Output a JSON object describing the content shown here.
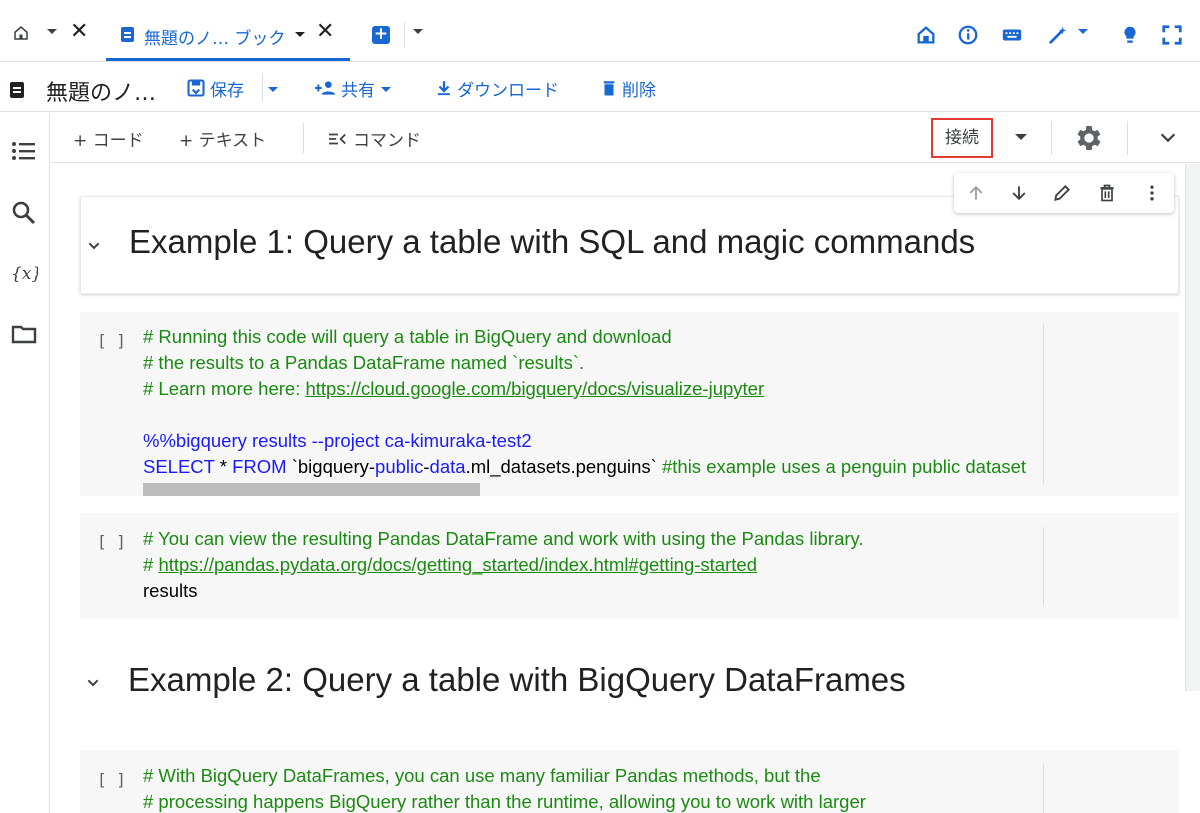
{
  "tabbar": {
    "active_tab_title": "無題のノ… ブック",
    "close_glyph": "✕",
    "new_tab_glyph": "+"
  },
  "toolbar": {
    "notebook_title": "無題のノ…",
    "save_label": "保存",
    "share_label": "共有",
    "download_label": "ダウンロード",
    "delete_label": "削除"
  },
  "commands": {
    "add_code": "+ コード",
    "add_text": "+ テキスト",
    "command_palette": "コマンド",
    "connect": "接続"
  },
  "cells": {
    "heading1": "Example 1: Query a table with SQL and magic commands",
    "code1": {
      "bracket": "[ ]",
      "line1": "# Running this code will query a table in BigQuery and download",
      "line2": "# the results to a Pandas DataFrame named `results`.",
      "line3_prefix": "# Learn more here: ",
      "line3_link": "https://cloud.google.com/bigquery/docs/visualize-jupyter",
      "line5": "%%bigquery results --project ca-kimuraka-test2",
      "line6_select": "SELECT",
      "line6_star": " * ",
      "line6_from": "FROM",
      "line6_tick1": " `bigquery-",
      "line6_public": "public",
      "line6_dash": "-",
      "line6_data": "data",
      "line6_rest": ".ml_datasets.penguins` ",
      "line6_comment": "#this example uses a penguin public dataset"
    },
    "code2": {
      "bracket": "[ ]",
      "line1": "# You can view the resulting Pandas DataFrame and work with using the Pandas library.",
      "line2_prefix": "# ",
      "line2_link": "https://pandas.pydata.org/docs/getting_started/index.html#getting-started",
      "line3": "results"
    },
    "heading2": "Example 2: Query a table with BigQuery DataFrames",
    "code3": {
      "bracket": "[ ]",
      "line1": "# With BigQuery DataFrames, you can use many familiar Pandas methods, but the",
      "line2": "# processing happens BigQuery rather than the runtime, allowing you to work with larger"
    }
  },
  "colors": {
    "accent": "#1967d2",
    "comment": "#1b8a12",
    "keyword": "#1a1aff",
    "connect_highlight": "#e53935"
  },
  "icons": {
    "tabbar": [
      "home-icon",
      "close-icon",
      "doc-icon",
      "add-tab-icon",
      "drive-icon",
      "info-icon",
      "keyboard-icon",
      "magic-wand-icon",
      "lightbulb-icon",
      "fullscreen-icon"
    ],
    "sidebar": [
      "toc-icon",
      "search-icon",
      "variables-icon",
      "folder-icon"
    ],
    "cell_toolbar": [
      "arrow-up-icon",
      "arrow-down-icon",
      "pencil-icon",
      "trash-icon",
      "more-vert-icon"
    ]
  }
}
